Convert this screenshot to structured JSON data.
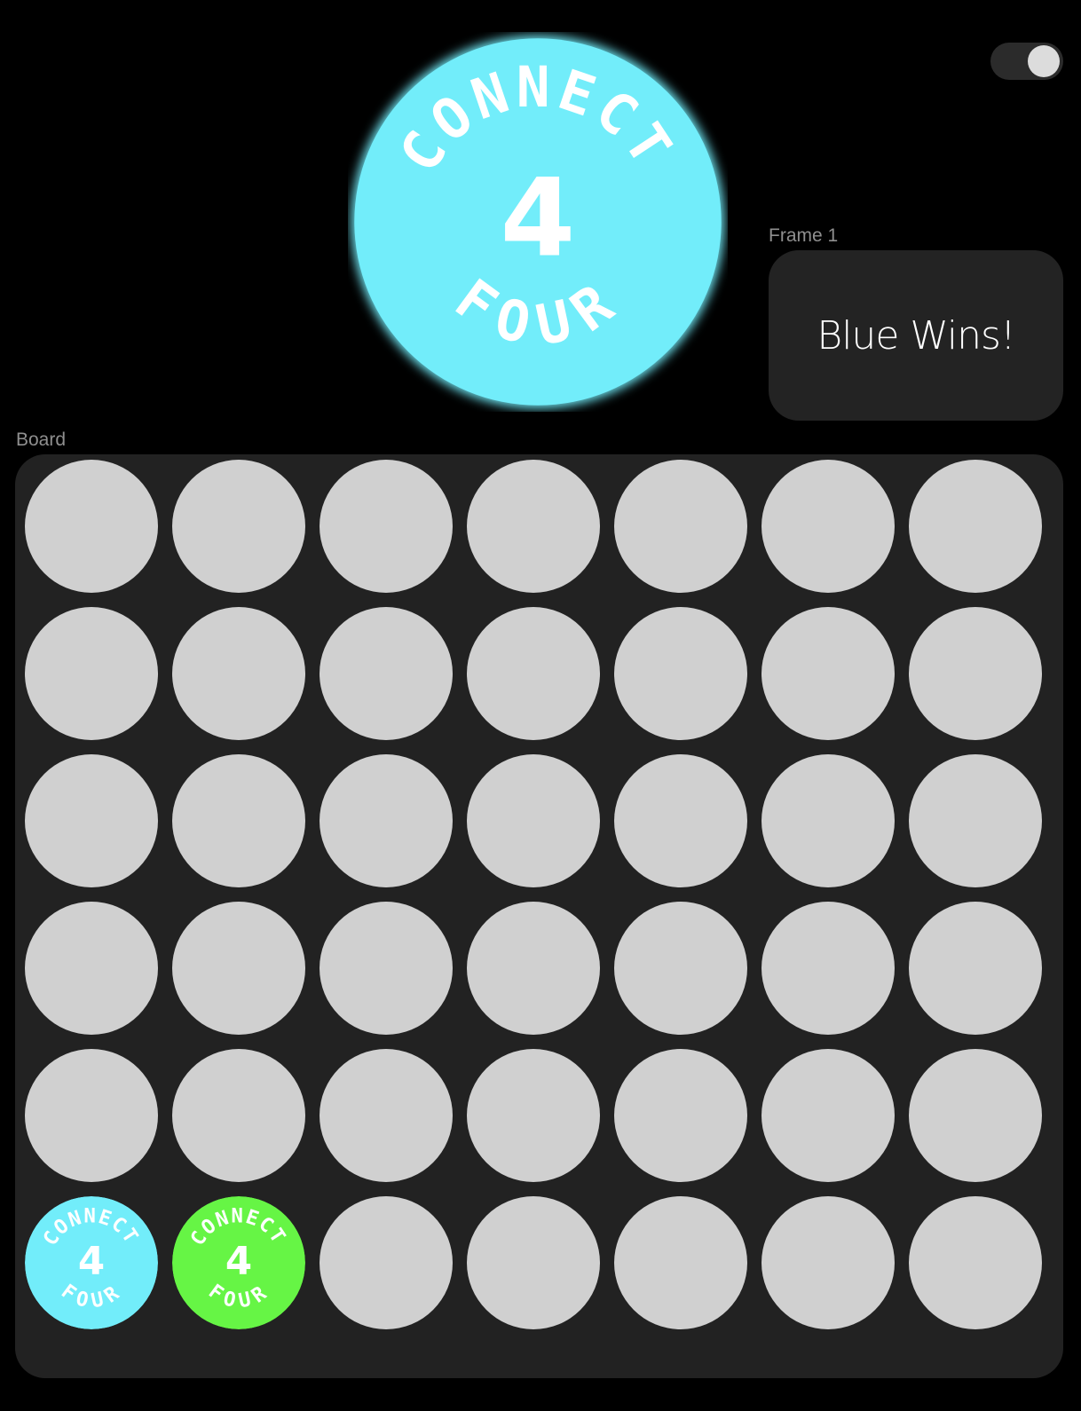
{
  "app": {
    "logo": {
      "arc_top": "CONNECT",
      "center": "4",
      "arc_bottom": "FOUR",
      "color": "#72edfa",
      "icon": "connect-four-logo-icon"
    },
    "toggle": {
      "state": "on",
      "icon": "toggle-switch"
    }
  },
  "status": {
    "frame_label": "Frame 1",
    "message": "Blue Wins!"
  },
  "board": {
    "label": "Board",
    "rows": 6,
    "columns": 7,
    "colors": {
      "empty": "#d0d0d0",
      "blue": "#72edfa",
      "green": "#66f545",
      "board_bg": "#222222"
    },
    "cells": [
      [
        "empty",
        "empty",
        "empty",
        "empty",
        "empty",
        "empty",
        "empty"
      ],
      [
        "empty",
        "empty",
        "empty",
        "empty",
        "empty",
        "empty",
        "empty"
      ],
      [
        "empty",
        "empty",
        "empty",
        "empty",
        "empty",
        "empty",
        "empty"
      ],
      [
        "empty",
        "empty",
        "empty",
        "empty",
        "empty",
        "empty",
        "empty"
      ],
      [
        "empty",
        "empty",
        "empty",
        "empty",
        "empty",
        "empty",
        "empty"
      ],
      [
        "blue",
        "green",
        "empty",
        "empty",
        "empty",
        "empty",
        "empty"
      ]
    ]
  }
}
